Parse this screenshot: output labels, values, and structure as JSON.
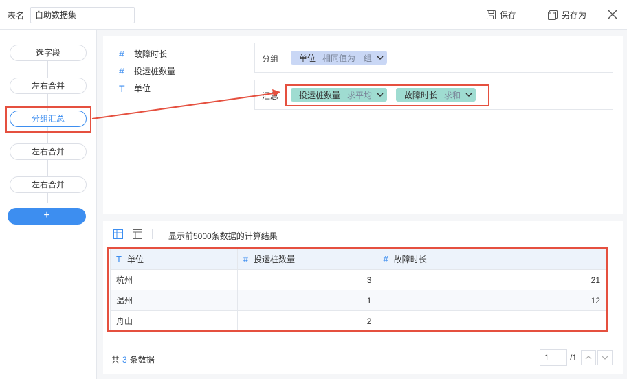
{
  "header": {
    "table_name_label": "表名",
    "table_name_value": "自助数据集",
    "save_label": "保存",
    "save_as_label": "另存为"
  },
  "sidebar": {
    "steps": [
      {
        "label": "选字段"
      },
      {
        "label": "左右合并"
      },
      {
        "label": "分组汇总"
      },
      {
        "label": "左右合并"
      },
      {
        "label": "左右合并"
      }
    ],
    "add_label": "+"
  },
  "fields": [
    {
      "icon": "#",
      "name": "故障时长"
    },
    {
      "icon": "#",
      "name": "投运桩数量"
    },
    {
      "icon": "T",
      "name": "单位"
    }
  ],
  "group_box": {
    "label": "分组",
    "pills": [
      {
        "name": "单位",
        "agg": "相同值为一组"
      }
    ]
  },
  "summary_box": {
    "label": "汇总",
    "pills": [
      {
        "name": "投运桩数量",
        "agg": "求平均"
      },
      {
        "name": "故障时长",
        "agg": "求和"
      }
    ]
  },
  "result": {
    "caption": "显示前5000条数据的计算结果",
    "columns": [
      {
        "icon": "T",
        "name": "单位"
      },
      {
        "icon": "#",
        "name": "投运桩数量"
      },
      {
        "icon": "#",
        "name": "故障时长"
      }
    ],
    "rows": [
      [
        "杭州",
        "3",
        "21"
      ],
      [
        "温州",
        "1",
        "12"
      ],
      [
        "舟山",
        "2",
        ""
      ]
    ],
    "count_prefix": "共",
    "count": "3",
    "count_suffix": "条数据"
  },
  "pager": {
    "page": "1",
    "total": "/1"
  },
  "colors": {
    "accent": "#3d8ef0",
    "group_pill": "#c9d7f5",
    "summary_pill": "#9fdcd1",
    "annotation": "#e5503f"
  }
}
